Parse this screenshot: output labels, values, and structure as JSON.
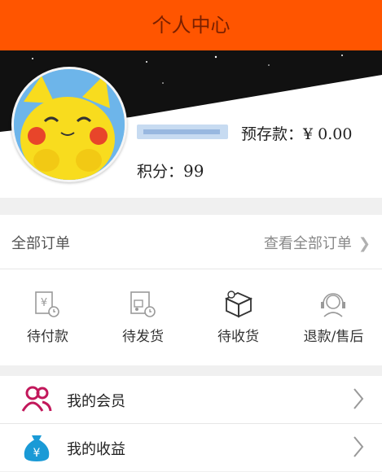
{
  "header": {
    "title": "个人中心"
  },
  "profile": {
    "deposit_label": "预存款：",
    "deposit_value": "¥ 0.00",
    "points_label": "积分：",
    "points_value": "99"
  },
  "orders": {
    "title": "全部订单",
    "view_all": "查看全部订单",
    "chevron": "❯"
  },
  "order_status": [
    {
      "label": "待付款",
      "icon": "wallet-icon"
    },
    {
      "label": "待发货",
      "icon": "truck-icon"
    },
    {
      "label": "待收货",
      "icon": "box-icon"
    },
    {
      "label": "退款/售后",
      "icon": "headset-icon"
    }
  ],
  "menu": [
    {
      "label": "我的会员",
      "icon": "members-icon"
    },
    {
      "label": "我的收益",
      "icon": "money-bag-icon"
    }
  ],
  "colors": {
    "accent": "#ff5500",
    "members_icon": "#c2185b",
    "money_icon": "#1a9ad6"
  }
}
